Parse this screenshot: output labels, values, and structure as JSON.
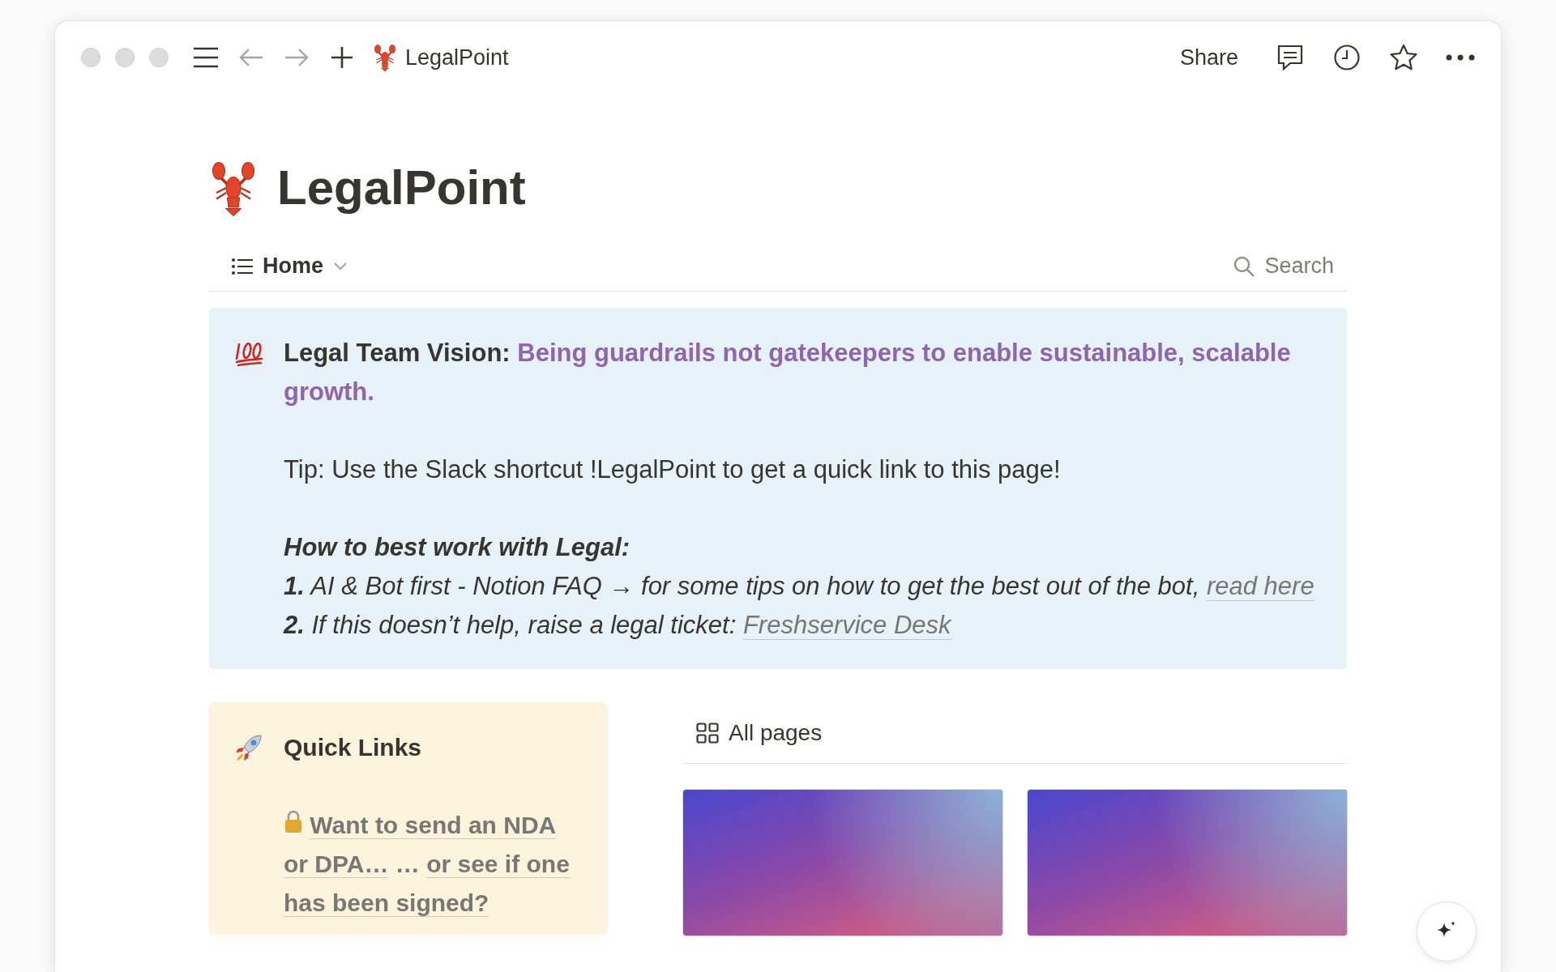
{
  "window": {
    "title": "LegalPoint"
  },
  "toolbar": {
    "share": "Share"
  },
  "page": {
    "title": "LegalPoint"
  },
  "view_bar": {
    "view": "Home",
    "search": "Search"
  },
  "callout": {
    "vision_label": "Legal Team Vision:",
    "vision_text": "Being guardrails not gatekeepers to enable sustainable, scalable growth.",
    "tip": "Tip: Use the Slack shortcut !LegalPoint to get a quick link to this page!",
    "heading": "How to best work with Legal:",
    "steps": [
      {
        "text": "**1.** AI & Bot first - Notion FAQ → for some tips on how to get the best out of the bot,",
        "link": "read here"
      },
      {
        "text": "**2.** If this doesn’t help, raise a legal ticket:",
        "link": "Freshservice Desk"
      }
    ]
  },
  "quick_links": {
    "title": "Quick Links",
    "parts": [
      {
        "kind": "link",
        "text": "Want to send an NDA or DPA…"
      },
      {
        "kind": "plain",
        "text": "…"
      },
      {
        "kind": "link",
        "text": "or see if one has been signed?"
      }
    ]
  },
  "gallery": {
    "view": "All pages",
    "cards": [
      {
        "kind": "cover"
      },
      {
        "kind": "cover"
      }
    ]
  }
}
